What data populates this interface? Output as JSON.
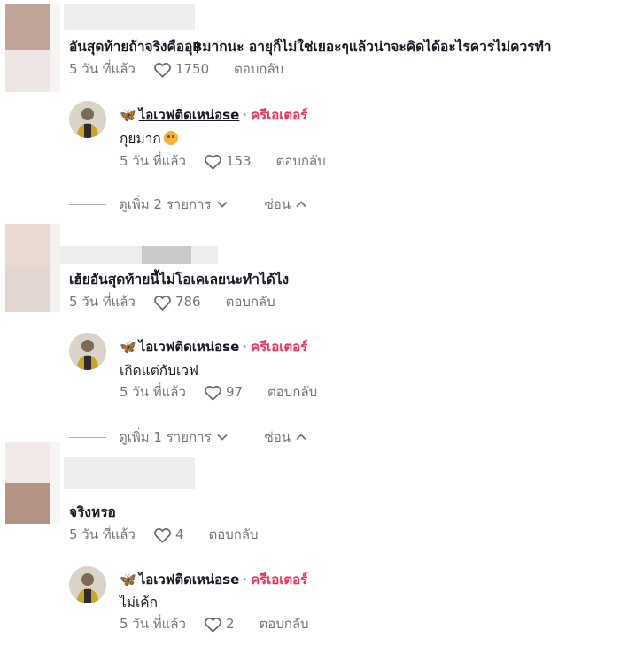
{
  "threads": [
    {
      "comment": "อันสุดท้ายถ้าจริงคืออุ฿มากนะ อายุก็ไม่ใช่เยอะๆแล้วน่าจะคิดได้อะไรควรไม่ควรทำ",
      "time": "5 วัน ที่แล้ว",
      "likes": "1750",
      "reply_label": "ตอบกลับ",
      "reply": {
        "name": "ไอเวฟติดเหน่อse",
        "separator": "·",
        "badge": "ครีเอเตอร์",
        "text": "กุยมาก",
        "time": "5 วัน ที่แล้ว",
        "likes": "153",
        "reply_label": "ตอบกลับ"
      },
      "view_more": "ดูเพิ่ม 2 รายการ",
      "hide": "ซ่อน"
    },
    {
      "comment": "เฮ้ยอันสุดท้ายนี้ไม่โอเคเลยนะทำได้ไง",
      "time": "5 วัน ที่แล้ว",
      "likes": "786",
      "reply_label": "ตอบกลับ",
      "reply": {
        "name": "ไอเวฟติดเหน่อse",
        "separator": "·",
        "badge": "ครีเอเตอร์",
        "text": "เกิดแต่กับเวฟ",
        "time": "5 วัน ที่แล้ว",
        "likes": "97",
        "reply_label": "ตอบกลับ"
      },
      "view_more": "ดูเพิ่ม 1 รายการ",
      "hide": "ซ่อน"
    },
    {
      "comment": "จริงหรอ",
      "time": "5 วัน ที่แล้ว",
      "likes": "4",
      "reply_label": "ตอบกลับ",
      "reply": {
        "name": "ไอเวฟติดเหน่อse",
        "separator": "·",
        "badge": "ครีเอเตอร์",
        "text": "ไม่เค้ก",
        "time": "5 วัน ที่แล้ว",
        "likes": "2",
        "reply_label": "ตอบกลับ"
      }
    }
  ],
  "colors": {
    "creator": "#fe2c55",
    "text": "#161823",
    "muted": "rgba(22,24,35,0.6)"
  },
  "icons": {
    "like": "heart-outline-icon",
    "expand": "chevron-down-icon",
    "collapse": "chevron-up-icon",
    "badge": "butterfly-icon"
  }
}
